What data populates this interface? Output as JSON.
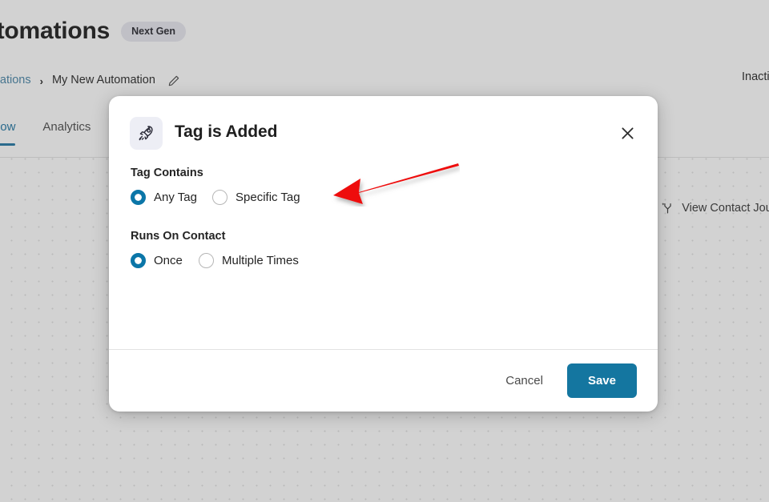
{
  "page": {
    "title": "Automations",
    "badge": "Next Gen",
    "breadcrumb": {
      "parent": "Automations",
      "separator": "›",
      "current": "My New Automation",
      "edit_icon": "pencil-icon"
    },
    "status": "Inactive",
    "tabs": [
      {
        "label": "Workflow",
        "active": true
      },
      {
        "label": "Analytics",
        "active": false
      }
    ],
    "journey_link": {
      "label": "View Contact Journey",
      "icon": "journey-branch-icon"
    }
  },
  "modal": {
    "icon": "rocket-icon",
    "title": "Tag is Added",
    "close_icon": "close-icon",
    "fields": [
      {
        "label": "Tag Contains",
        "options": [
          {
            "label": "Any Tag",
            "selected": true
          },
          {
            "label": "Specific Tag",
            "selected": false
          }
        ]
      },
      {
        "label": "Runs On Contact",
        "options": [
          {
            "label": "Once",
            "selected": true
          },
          {
            "label": "Multiple Times",
            "selected": false
          }
        ]
      }
    ],
    "footer": {
      "cancel_label": "Cancel",
      "save_label": "Save"
    }
  },
  "annotation": {
    "type": "arrow",
    "direction": "left",
    "color": "#ee1111"
  },
  "colors": {
    "accent_blue": "#0b76a8",
    "save_button": "#1476a0",
    "tab_active": "#2a6a8c",
    "canvas": "#d2d2d2",
    "modal_bg": "#ffffff",
    "annotation_red": "#ee1111"
  }
}
